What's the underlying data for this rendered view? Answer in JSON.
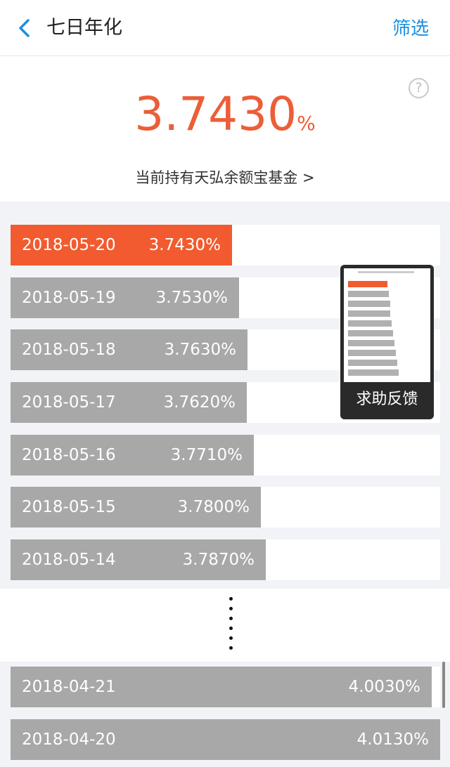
{
  "header": {
    "title": "七日年化",
    "filter_label": "筛选"
  },
  "summary": {
    "rate_value": "3.7430",
    "rate_unit": "%",
    "fund_link": "当前持有天弘余额宝基金 >",
    "help_symbol": "?"
  },
  "rows_top": [
    {
      "date": "2018-05-20",
      "value": "3.7430%",
      "active": true
    },
    {
      "date": "2018-05-19",
      "value": "3.7530%",
      "active": false
    },
    {
      "date": "2018-05-18",
      "value": "3.7630%",
      "active": false
    },
    {
      "date": "2018-05-17",
      "value": "3.7620%",
      "active": false
    },
    {
      "date": "2018-05-16",
      "value": "3.7710%",
      "active": false
    },
    {
      "date": "2018-05-15",
      "value": "3.7800%",
      "active": false
    },
    {
      "date": "2018-05-14",
      "value": "3.7870%",
      "active": false
    }
  ],
  "rows_bottom": [
    {
      "date": "2018-04-21",
      "value": "4.0030%",
      "active": false
    },
    {
      "date": "2018-04-20",
      "value": "4.0130%",
      "active": false
    }
  ],
  "feedback": {
    "label": "求助反馈"
  },
  "colors": {
    "accent": "#f15b2f",
    "link": "#1a8fe0",
    "bar": "#a8a8a8"
  }
}
